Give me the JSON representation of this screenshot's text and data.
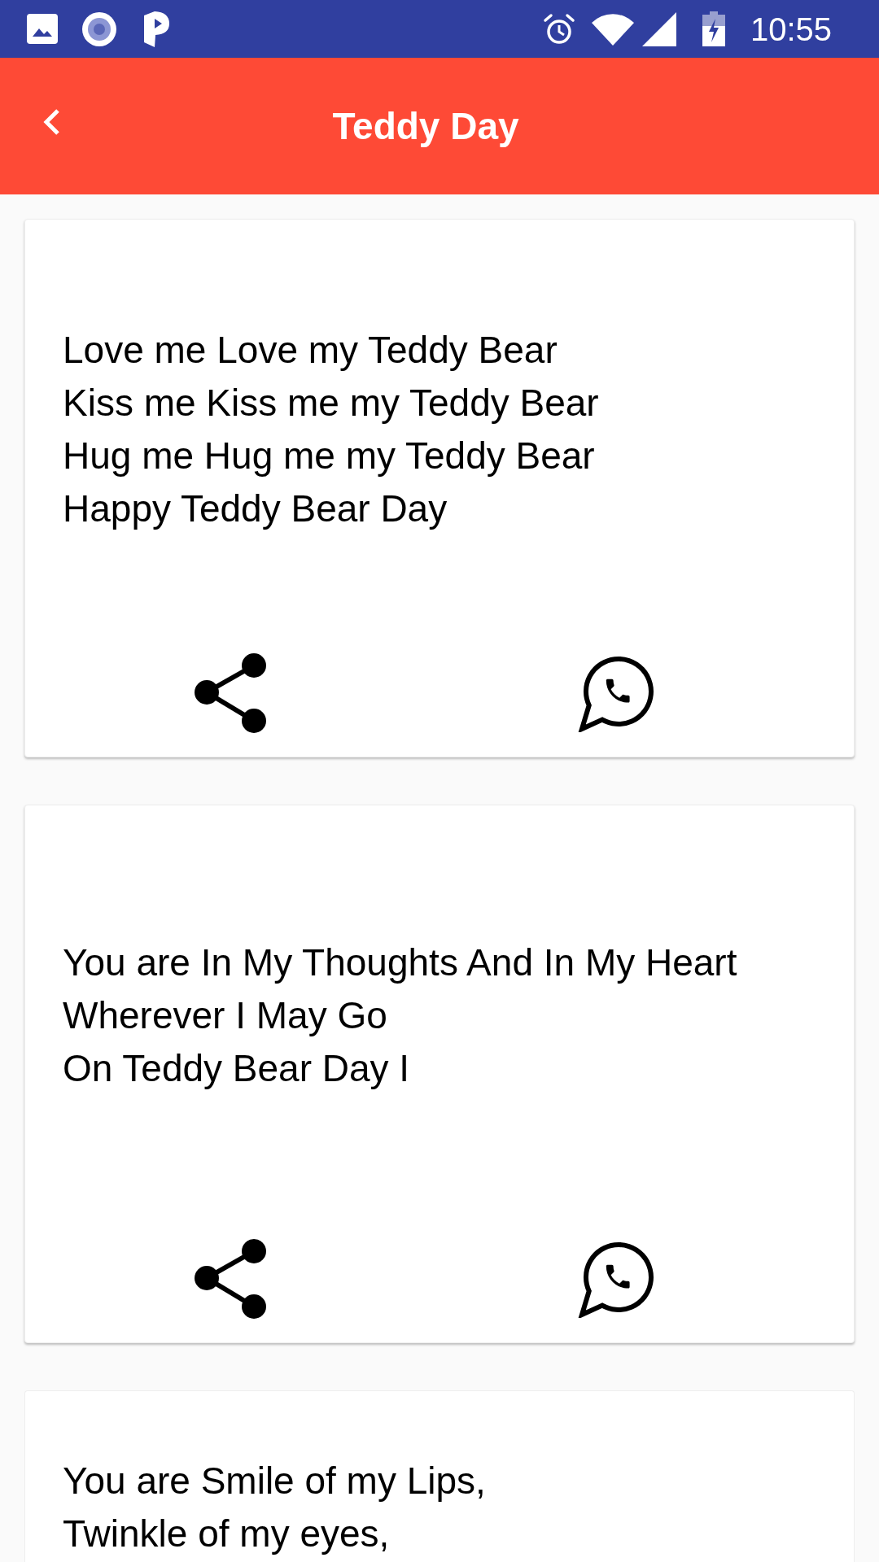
{
  "status_bar": {
    "time": "10:55"
  },
  "app_bar": {
    "title": "Teddy Day"
  },
  "cards": [
    {
      "text": "Love me Love my Teddy Bear\nKiss me Kiss me my Teddy Bear\nHug me Hug me my Teddy Bear\nHappy Teddy Bear Day",
      "actions": [
        {
          "kind": "share"
        },
        {
          "kind": "message"
        }
      ]
    },
    {
      "text": "You are In My Thoughts And In My Heart\nWherever I May Go\nOn Teddy Bear Day I",
      "actions": [
        {
          "kind": "share"
        },
        {
          "kind": "message"
        }
      ]
    },
    {
      "text": "You are Smile of my Lips,\nTwinkle of my eyes,"
    }
  ]
}
